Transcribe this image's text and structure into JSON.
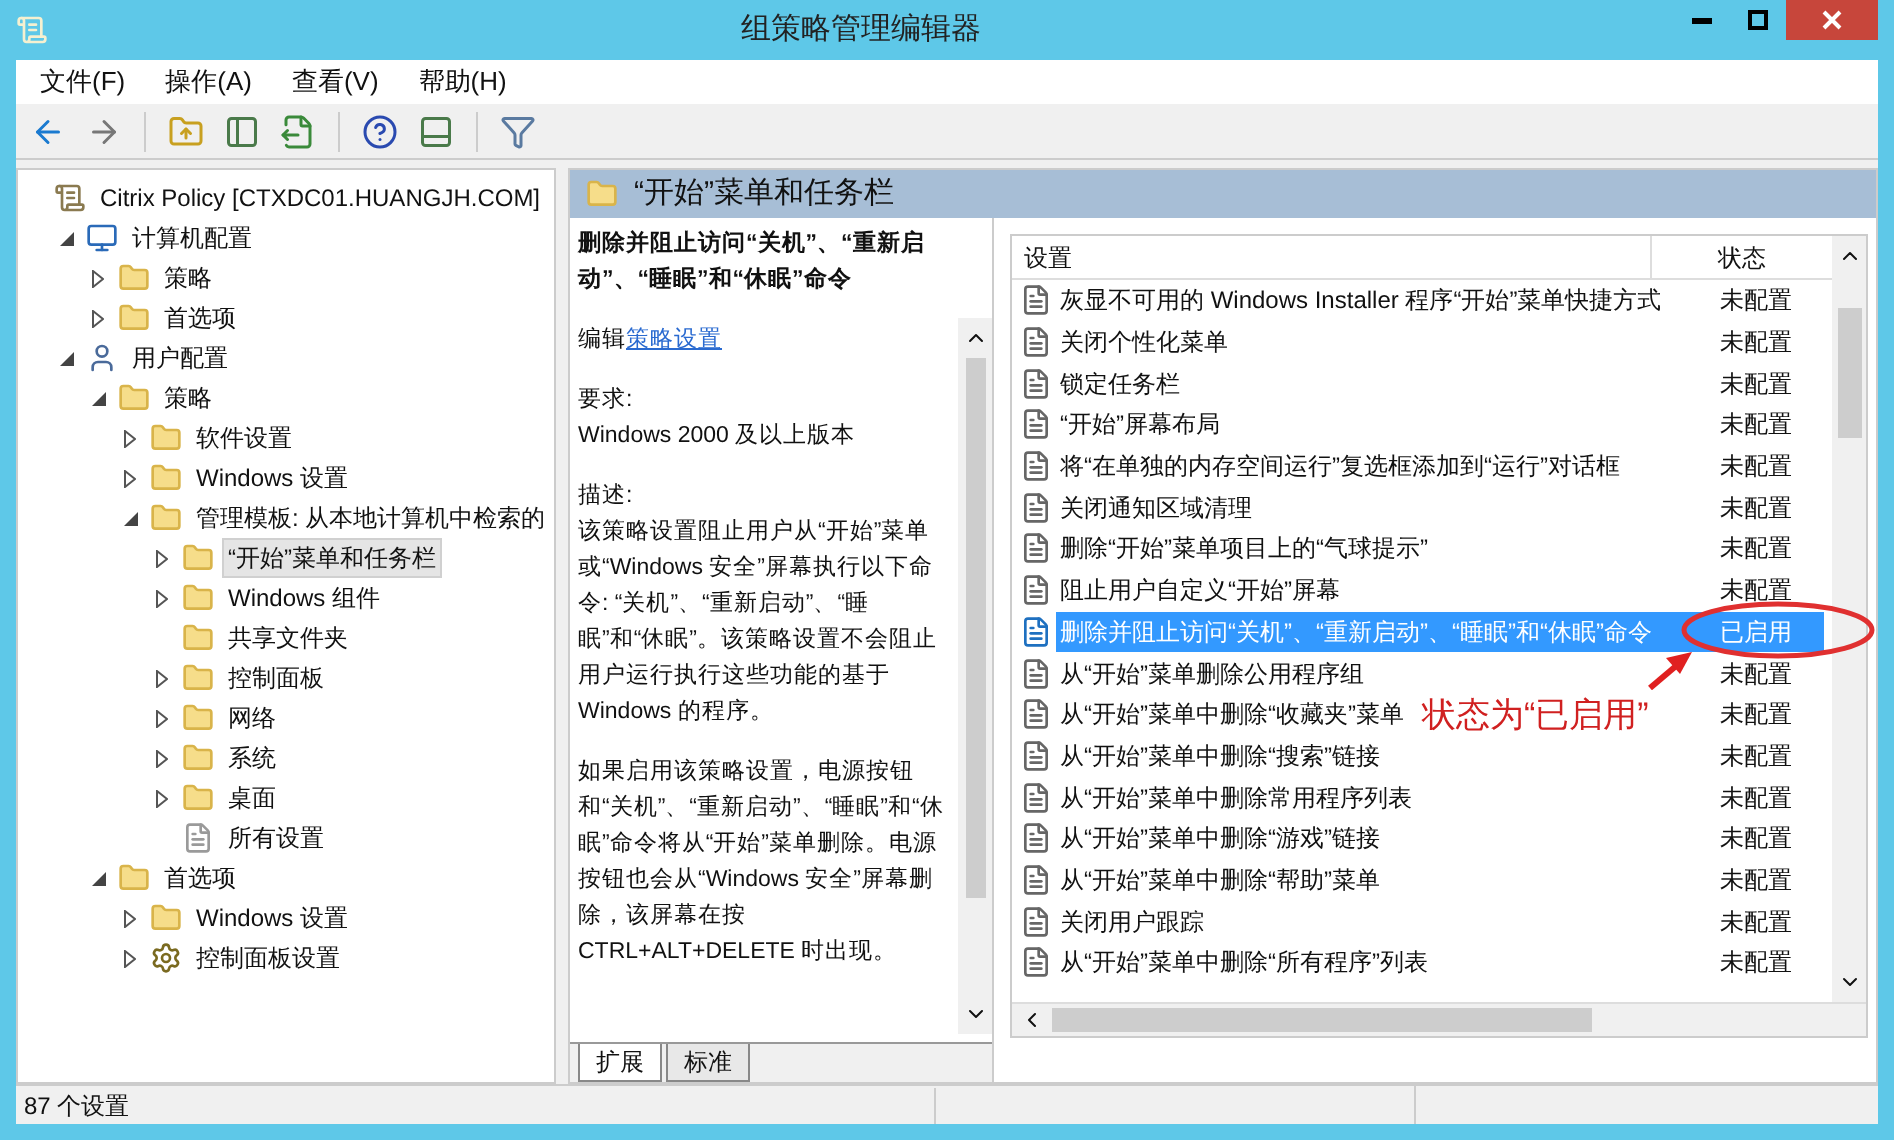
{
  "window": {
    "title": "组策略管理编辑器"
  },
  "menu": [
    "文件(F)",
    "操作(A)",
    "查看(V)",
    "帮助(H)"
  ],
  "tree": [
    {
      "label": "Citrix Policy [CTXDC01.HUANGJH.COM]",
      "kind": "root",
      "selected": false,
      "children": [
        {
          "label": "计算机配置",
          "kind": "computer",
          "expanded": true,
          "selected": false,
          "children": [
            {
              "label": "策略",
              "kind": "folder",
              "expanded": false,
              "selected": false
            },
            {
              "label": "首选项",
              "kind": "folder",
              "expanded": false,
              "selected": false
            }
          ]
        },
        {
          "label": "用户配置",
          "kind": "user",
          "expanded": true,
          "selected": false,
          "children": [
            {
              "label": "策略",
              "kind": "folder",
              "expanded": true,
              "selected": false,
              "children": [
                {
                  "label": "软件设置",
                  "kind": "folder",
                  "expanded": false,
                  "selected": false
                },
                {
                  "label": "Windows 设置",
                  "kind": "folder",
                  "expanded": false,
                  "selected": false
                },
                {
                  "label": "管理模板: 从本地计算机中检索的",
                  "kind": "folder",
                  "expanded": true,
                  "selected": false,
                  "children": [
                    {
                      "label": "“开始”菜单和任务栏",
                      "kind": "folder",
                      "expanded": false,
                      "selected": true
                    },
                    {
                      "label": "Windows 组件",
                      "kind": "folder",
                      "expanded": false,
                      "selected": false
                    },
                    {
                      "label": "共享文件夹",
                      "kind": "folder",
                      "selected": false
                    },
                    {
                      "label": "控制面板",
                      "kind": "folder",
                      "expanded": false,
                      "selected": false
                    },
                    {
                      "label": "网络",
                      "kind": "folder",
                      "expanded": false,
                      "selected": false
                    },
                    {
                      "label": "系统",
                      "kind": "folder",
                      "expanded": false,
                      "selected": false
                    },
                    {
                      "label": "桌面",
                      "kind": "folder",
                      "expanded": false,
                      "selected": false
                    },
                    {
                      "label": "所有设置",
                      "kind": "settings",
                      "selected": false
                    }
                  ]
                }
              ]
            },
            {
              "label": "首选项",
              "kind": "folder",
              "expanded": true,
              "selected": false,
              "children": [
                {
                  "label": "Windows 设置",
                  "kind": "folder",
                  "expanded": false,
                  "selected": false
                },
                {
                  "label": "控制面板设置",
                  "kind": "controlpanel",
                  "expanded": false,
                  "selected": false
                }
              ]
            }
          ]
        }
      ]
    }
  ],
  "pane": {
    "title": "“开始”菜单和任务栏",
    "description": {
      "heading": "删除并阻止访问“关机”、“重新启动”、“睡眠”和“休眠”命令",
      "edit_prefix": "编辑",
      "edit_link": "策略设置",
      "requirements_label": "要求:",
      "requirements": "Windows 2000 及以上版本",
      "description_label": "描述:",
      "paragraphs": [
        "该策略设置阻止用户从“开始”菜单或“Windows 安全”屏幕执行以下命令: “关机”、“重新启动”、“睡眠”和“休眠”。该策略设置不会阻止用户运行执行这些功能的基于 Windows 的程序。",
        "如果启用该策略设置，电源按钮和“关机”、“重新启动”、“睡眠”和“休眠”命令将从“开始”菜单删除。电源按钮也会从“Windows 安全”屏幕删除，该屏幕在按 CTRL+ALT+DELETE 时出现。"
      ]
    },
    "columns": [
      "设置",
      "状态"
    ],
    "rows": [
      {
        "setting": "灰显不可用的 Windows Installer 程序“开始”菜单快捷方式",
        "state": "未配置",
        "selected": false
      },
      {
        "setting": "关闭个性化菜单",
        "state": "未配置",
        "selected": false
      },
      {
        "setting": "锁定任务栏",
        "state": "未配置",
        "selected": false
      },
      {
        "setting": "“开始”屏幕布局",
        "state": "未配置",
        "selected": false
      },
      {
        "setting": "将“在单独的内存空间运行”复选框添加到“运行”对话框",
        "state": "未配置",
        "selected": false
      },
      {
        "setting": "关闭通知区域清理",
        "state": "未配置",
        "selected": false
      },
      {
        "setting": "删除“开始”菜单项目上的“气球提示”",
        "state": "未配置",
        "selected": false
      },
      {
        "setting": "阻止用户自定义“开始”屏幕",
        "state": "未配置",
        "selected": false
      },
      {
        "setting": "删除并阻止访问“关机”、“重新启动”、“睡眠”和“休眠”命令",
        "state": "已启用",
        "selected": true
      },
      {
        "setting": "从“开始”菜单删除公用程序组",
        "state": "未配置",
        "selected": false
      },
      {
        "setting": "从“开始”菜单中删除“收藏夹”菜单",
        "state": "未配置",
        "selected": false
      },
      {
        "setting": "从“开始”菜单中删除“搜索”链接",
        "state": "未配置",
        "selected": false
      },
      {
        "setting": "从“开始”菜单中删除常用程序列表",
        "state": "未配置",
        "selected": false
      },
      {
        "setting": "从“开始”菜单中删除“游戏”链接",
        "state": "未配置",
        "selected": false
      },
      {
        "setting": "从“开始”菜单中删除“帮助”菜单",
        "state": "未配置",
        "selected": false
      },
      {
        "setting": "关闭用户跟踪",
        "state": "未配置",
        "selected": false
      },
      {
        "setting": "从“开始”菜单中删除“所有程序”列表",
        "state": "未配置",
        "selected": false
      }
    ],
    "annotation": "状态为“已启用”",
    "tabs": [
      {
        "label": "扩展",
        "selected": true
      },
      {
        "label": "标准",
        "selected": false
      }
    ]
  },
  "status_bar": "87 个设置"
}
